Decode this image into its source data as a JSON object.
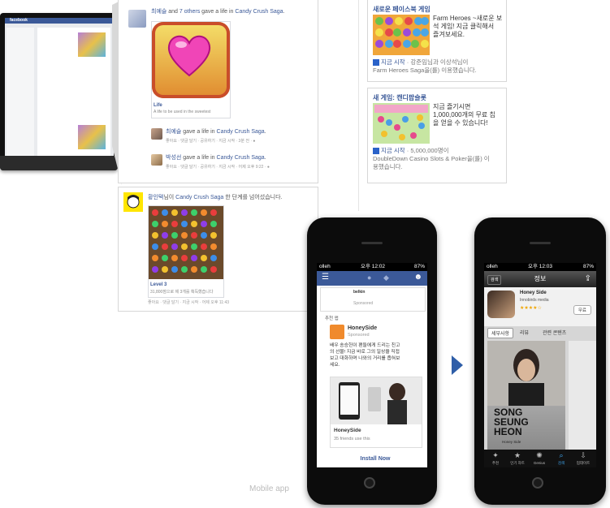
{
  "desktop": {
    "logo": "facebook"
  },
  "feed": {
    "story1": {
      "actor": "최예슬",
      "mid": " and ",
      "others": "7 others",
      "verb": " gave a life in ",
      "game": "Candy Crush Saga",
      "end": ".",
      "card_title": "Life",
      "card_desc": "A life to be used in the sweetest"
    },
    "story2": {
      "actor": "최예슬",
      "verb": " gave a life in ",
      "game": "Candy Crush Saga",
      "end": ".",
      "meta": "좋아요 · 댓글 달기 · 공유하기 · 지금 시작 · 3분 전 · "
    },
    "story3": {
      "actor": "박성선",
      "verb": " gave a life in ",
      "game": "Candy Crush Saga",
      "end": ".",
      "meta": "좋아요 · 댓글 달기 · 공유하기 · 지금 시작 · 어제 오후 9:22 · "
    },
    "story4": {
      "actor": "황인택",
      "mid": "님이 ",
      "game": "Candy Crush Saga",
      "verb": " 한 단계를 넘어섰습니다.",
      "card_title": "Level 3",
      "card_desc": "31,800점으로 제 3개를 획득했습니다",
      "meta": "좋아요 · 댓글 달기 · 지금 시작 · 어제 오후 11:43"
    }
  },
  "ads": {
    "ad1": {
      "title": "새로운 페이스북 게임",
      "line1": "Farm Heroes ~새로운 보",
      "line2": "석 게임! 지금 클릭해서",
      "line3": "즐겨보세요.",
      "cta": "지금 시작",
      "foot1": " · 강준임님과 이상석님이",
      "foot2": "Farm Heroes Saga을(를) 이용했습니다."
    },
    "ad2": {
      "title": "새 게임: 캔디팝슬롯",
      "line1": "지금 즐기시면",
      "line2": "1,000,000개의 무료 칩",
      "line3": "을 얻을 수 있습니다!",
      "cta": "지금 시작",
      "foot1": " · 5,000,000명이",
      "foot2": "DoubleDown Casino Slots & Poker을(를) 이",
      "foot3": "용했습니다."
    }
  },
  "phone1": {
    "carrier": "olleh",
    "time": "오후 12:02",
    "battery": "87%",
    "prev_brand": "belkin",
    "prev_sponsored": "Sponsored",
    "section": "추천 앱",
    "app_name": "HoneySide",
    "sponsored": "Sponsored",
    "body1": "배우 송승헌이 팬들에게 드리는 친고",
    "body2": "의 선물! 지금 바로 그의 일상을 직접",
    "body3": "보고 대화하며 나와의 거리를 좁혀보",
    "body4": "세요.",
    "card_name": "HoneySide",
    "card_friends": "35 friends use this",
    "install": "Install Now"
  },
  "phone2": {
    "carrier": "olleh",
    "time": "오후 12:03",
    "battery": "87%",
    "back": "검색",
    "title": "정보",
    "app_name": "Honey Side",
    "dev": "Innobirds media",
    "free": "무료",
    "tabs": [
      "세부사항",
      "리뷰",
      "관련 콘텐츠"
    ],
    "poster1": "SONG",
    "poster2": "SEUNG",
    "poster3": "HEON",
    "poster_sub": "Honey Side",
    "tabbar": [
      "추천",
      "인기 차트",
      "Genius",
      "검색",
      "업데이트"
    ]
  },
  "caption": "Mobile app",
  "colors": {
    "fb_blue": "#3b5998",
    "accent_arrow": "#2f5ea8"
  }
}
